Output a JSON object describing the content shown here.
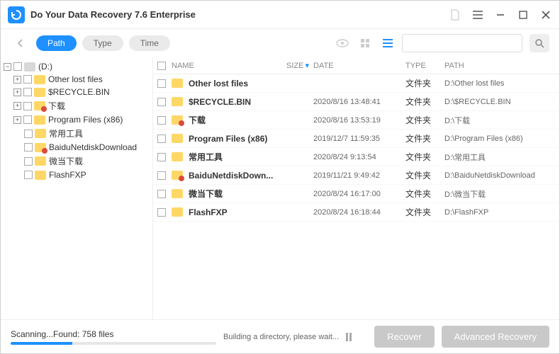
{
  "app": {
    "title": "Do Your Data Recovery 7.6 Enterprise"
  },
  "filters": {
    "path": "Path",
    "type": "Type",
    "time": "Time"
  },
  "search": {
    "placeholder": ""
  },
  "tree": {
    "root": "(D:)",
    "items": [
      {
        "label": "Other lost files",
        "red": false,
        "exp": "+"
      },
      {
        "label": "$RECYCLE.BIN",
        "red": false,
        "exp": "+"
      },
      {
        "label": "下载",
        "red": true,
        "exp": "+"
      },
      {
        "label": "Program Files (x86)",
        "red": false,
        "exp": "+"
      },
      {
        "label": "常用工具",
        "red": false,
        "exp": ""
      },
      {
        "label": "BaiduNetdiskDownload",
        "red": true,
        "exp": ""
      },
      {
        "label": "微当下载",
        "red": false,
        "exp": ""
      },
      {
        "label": "FlashFXP",
        "red": false,
        "exp": ""
      }
    ]
  },
  "columns": {
    "name": "NAME",
    "size": "SIZE",
    "date": "DATE",
    "type": "TYPE",
    "path": "PATH"
  },
  "files": [
    {
      "name": "Other lost files",
      "date": "",
      "type": "文件夹",
      "path": "D:\\Other lost files",
      "red": false
    },
    {
      "name": "$RECYCLE.BIN",
      "date": "2020/8/16 13:48:41",
      "type": "文件夹",
      "path": "D:\\$RECYCLE.BIN",
      "red": false
    },
    {
      "name": "下载",
      "date": "2020/8/16 13:53:19",
      "type": "文件夹",
      "path": "D:\\下载",
      "red": true
    },
    {
      "name": "Program Files (x86)",
      "date": "2019/12/7 11:59:35",
      "type": "文件夹",
      "path": "D:\\Program Files (x86)",
      "red": false
    },
    {
      "name": "常用工具",
      "date": "2020/8/24 9:13:54",
      "type": "文件夹",
      "path": "D:\\常用工具",
      "red": false
    },
    {
      "name": "BaiduNetdiskDown...",
      "date": "2019/11/21 9:49:42",
      "type": "文件夹",
      "path": "D:\\BaiduNetdiskDownload",
      "red": true
    },
    {
      "name": "微当下载",
      "date": "2020/8/24 16:17:00",
      "type": "文件夹",
      "path": "D:\\微当下载",
      "red": false
    },
    {
      "name": "FlashFXP",
      "date": "2020/8/24 16:18:44",
      "type": "文件夹",
      "path": "D:\\FlashFXP",
      "red": false
    }
  ],
  "footer": {
    "status": "Scanning...Found: 758 files",
    "building": "Building a directory, please wait...",
    "progress_pct": 30,
    "recover": "Recover",
    "advanced": "Advanced Recovery"
  }
}
